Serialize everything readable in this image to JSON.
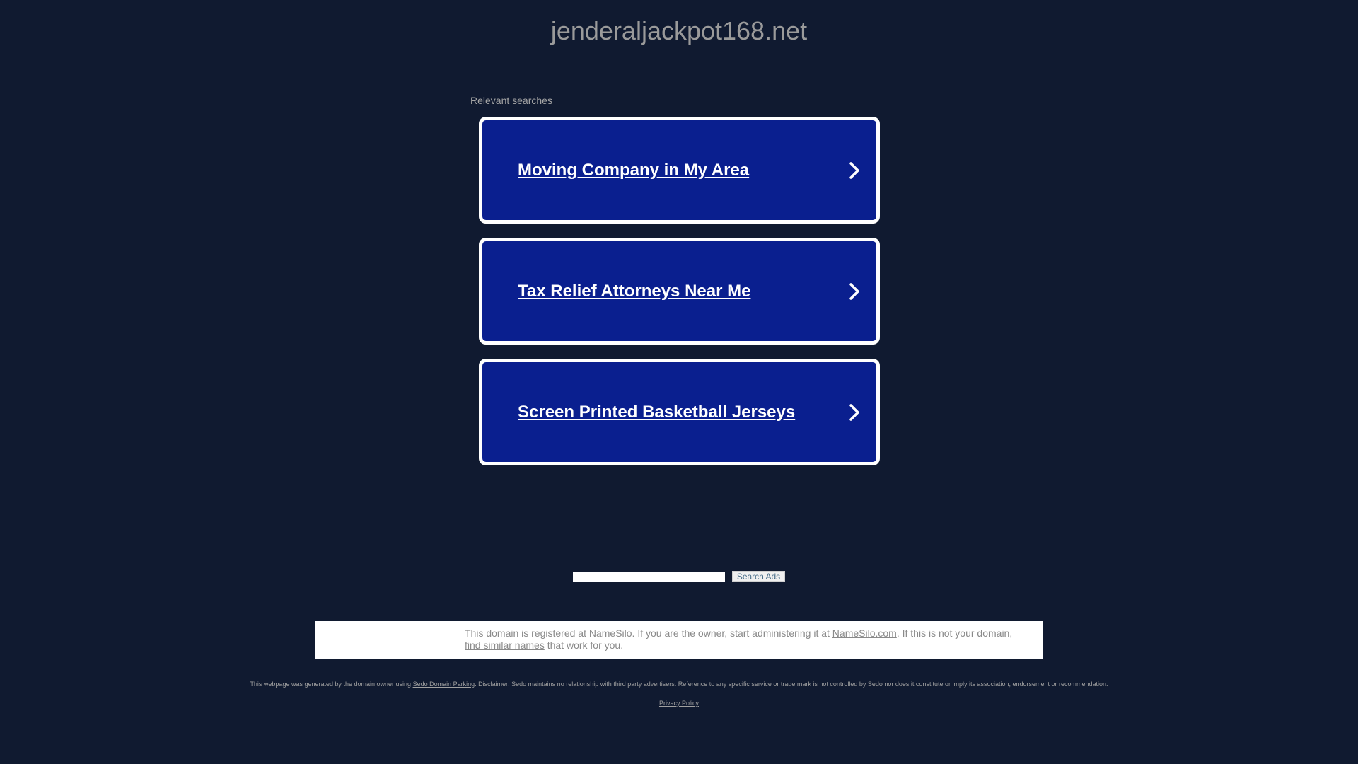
{
  "header": {
    "domain": "jenderaljackpot168.net"
  },
  "relevant": {
    "label": "Relevant searches",
    "items": [
      {
        "label": "Moving Company in My Area"
      },
      {
        "label": "Tax Relief Attorneys Near Me"
      },
      {
        "label": "Screen Printed Basketball Jerseys"
      }
    ]
  },
  "search": {
    "value": "",
    "button_label": "Search Ads"
  },
  "namesilo": {
    "text_before": "This domain is registered at NameSilo. If you are the owner, start administering it at ",
    "link1": "NameSilo.com",
    "text_middle": ". If this is not your domain, ",
    "link2": "find similar names",
    "text_after": " that work for you."
  },
  "footer": {
    "disclaimer_before": "This webpage was generated by the domain owner using ",
    "sedo_link": "Sedo Domain Parking",
    "disclaimer_after": ". Disclaimer: Sedo maintains no relationship with third party advertisers. Reference to any specific service or trade mark is not controlled by Sedo nor does it constitute or imply its association, endorsement or recommendation.",
    "privacy_link": "Privacy Policy"
  },
  "colors": {
    "background": "#101a30",
    "card_fill": "#0a1f8f",
    "card_border": "#ffffff"
  },
  "icons": {
    "card_arrow": "chevron-right-icon"
  }
}
